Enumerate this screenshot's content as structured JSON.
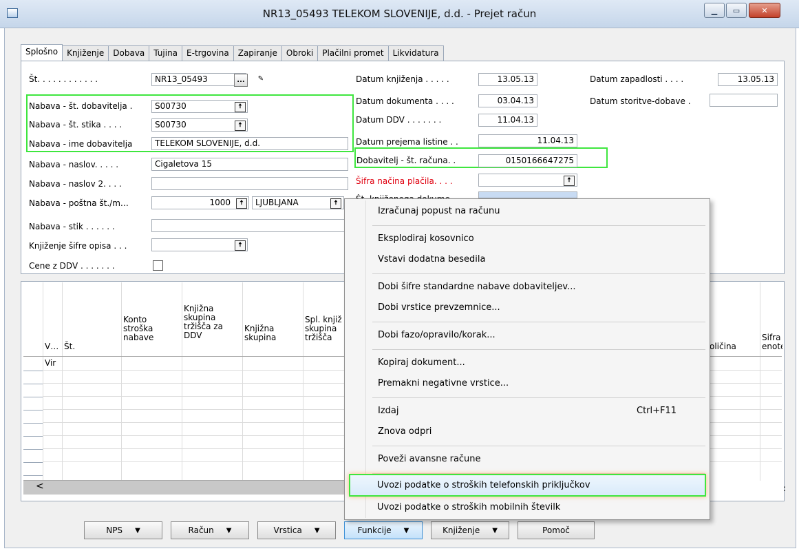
{
  "window": {
    "title": "NR13_05493 TELEKOM SLOVENIJE, d.d. - Prejet račun",
    "icons": [
      "app-icon",
      "minimize-icon",
      "maximize-icon",
      "close-icon"
    ]
  },
  "tabs": [
    {
      "label": "Splošno",
      "active": true
    },
    {
      "label": "Knjiženje"
    },
    {
      "label": "Dobava"
    },
    {
      "label": "Tujina"
    },
    {
      "label": "E-trgovina"
    },
    {
      "label": "Zapiranje"
    },
    {
      "label": "Obroki"
    },
    {
      "label": "Plačilni promet"
    },
    {
      "label": "Likvidatura"
    }
  ],
  "general": {
    "st": {
      "label": "Št. . . . . . . . . . . .",
      "value": "NR13_05493",
      "assist": "..."
    },
    "vendor_no": {
      "label": "Nabava - št. dobavitelja .",
      "value": "S00730"
    },
    "contact_no": {
      "label": "Nabava - št. stika . . . .",
      "value": "S00730"
    },
    "vendor_name": {
      "label": "Nabava - ime dobavitelja",
      "value": "TELEKOM SLOVENIJE, d.d."
    },
    "address": {
      "label": "Nabava - naslov. . . . .",
      "value": "Cigaletova 15"
    },
    "address2": {
      "label": "Nabava - naslov 2. . . .",
      "value": ""
    },
    "post_code": {
      "label": "Nabava - poštna št./m…",
      "value": "1000",
      "city": "LJUBLJANA"
    },
    "contact": {
      "label": "Nabava - stik . . . . . .",
      "value": ""
    },
    "desc_code": {
      "label": "Knjiženje šifre opisa . . .",
      "value": ""
    },
    "prices_vat": {
      "label": "Cene z DDV . . . . . . .",
      "checked": false
    }
  },
  "dates": {
    "posting": {
      "label": "Datum knjiženja . . . . .",
      "value": "13.05.13"
    },
    "document": {
      "label": "Datum dokumenta . . . .",
      "value": "03.04.13"
    },
    "vat": {
      "label": "Datum DDV . . . . . . .",
      "value": "11.04.13"
    },
    "receipt": {
      "label": "Datum prejema listine . .",
      "value": "11.04.13"
    },
    "vendor_invoice": {
      "label": "Dobavitelj - št. računa. .",
      "value": "0150166647275"
    },
    "payment_method": {
      "label": "Šifra načina plačila. . . .",
      "value": ""
    },
    "posting_doc": {
      "label": "Št. knjiženega dokume…"
    },
    "due": {
      "label": "Datum zapadlosti . . . .",
      "value": "13.05.13"
    },
    "service_supply": {
      "label": "Datum storitve-dobave .",
      "value": ""
    }
  },
  "lines": {
    "headers": [
      "V…",
      "Št.",
      "Konto stroška nabave",
      "Knjižna skupina tržišča za DDV",
      "Knjižna skupina",
      "Spl. knjiž skupina tržišča",
      "oličina",
      "Šifra enote"
    ],
    "first_row_marker": "✱▸",
    "first_row_type": "Vir",
    "scroll_left": "<",
    "scroll_right": ":"
  },
  "context_menu": {
    "items": [
      {
        "label": "Izračunaj popust na računu"
      },
      {
        "label": "Eksplodiraj kosovnico"
      },
      {
        "label": "Vstavi dodatna besedila"
      },
      {
        "label": "Dobi šifre standardne nabave dobaviteljev..."
      },
      {
        "label": "Dobi vrstice prevzemnice..."
      },
      {
        "label": "Dobi fazo/opravilo/korak..."
      },
      {
        "label": "Kopiraj dokument..."
      },
      {
        "label": "Premakni negativne vrstice..."
      },
      {
        "label": "Izdaj",
        "shortcut": "Ctrl+F11"
      },
      {
        "label": "Znova odpri"
      },
      {
        "label": "Poveži avansne račune"
      },
      {
        "label": "Uvozi podatke o stroških telefonskih priključkov",
        "highlighted": true
      },
      {
        "label": "Uvozi podatke o stroških mobilnih številk"
      }
    ]
  },
  "bottom_buttons": [
    {
      "label": "NPS"
    },
    {
      "label": "Račun"
    },
    {
      "label": "Vrstica"
    },
    {
      "label": "Funkcije",
      "active": true
    },
    {
      "label": "Knjiženje"
    },
    {
      "label": "Pomoč"
    }
  ],
  "colors": {
    "highlight_box": "#3ee63e",
    "required_label": "#e0000f",
    "accent_blue": "#c8dbf3"
  }
}
